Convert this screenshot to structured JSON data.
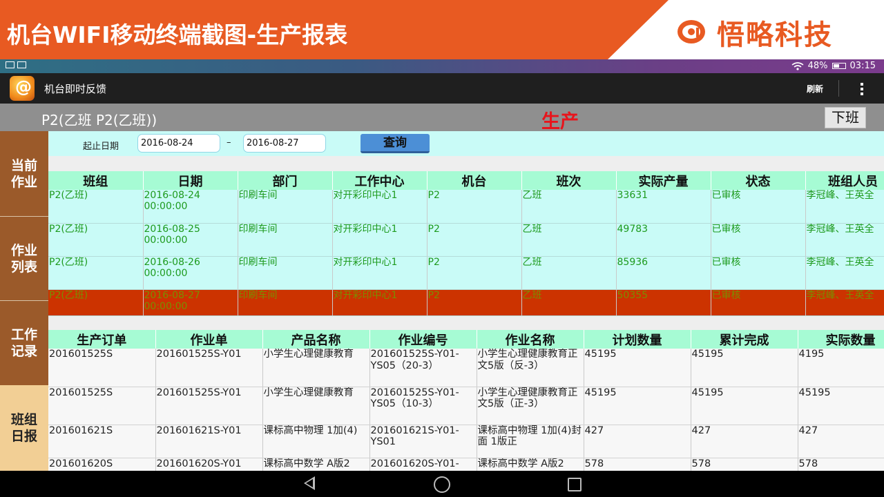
{
  "banner": {
    "title": "机台WIFI移动终端截图-生产报表",
    "brand": "悟略科技",
    "brand_color": "#e85a22"
  },
  "status_bar": {
    "battery": "48%",
    "time": "03:15",
    "icons": [
      "image-icon",
      "keyboard-icon",
      "wifi-icon",
      "battery-icon"
    ]
  },
  "app": {
    "title": "机台即时反馈",
    "refresh_label": "刷新",
    "overflow_icon": "more-vertical-icon"
  },
  "header": {
    "machine": "P2(乙班 P2(乙班))",
    "mode": "生产",
    "off_duty_label": "下班",
    "mode_color": "#e8141c"
  },
  "nav": {
    "items": [
      {
        "label": "当前作业"
      },
      {
        "label": "作业列表"
      },
      {
        "label": "工作记录"
      },
      {
        "label": "班组日报"
      }
    ]
  },
  "filter": {
    "label": "起止日期",
    "start_date": "2016-08-24",
    "separator": "–",
    "end_date": "2016-08-27",
    "query_label": "查询"
  },
  "report_table": {
    "headers": [
      "班组",
      "日期",
      "部门",
      "工作中心",
      "机台",
      "班次",
      "实际产量",
      "状态",
      "班组人员"
    ],
    "rows": [
      {
        "team": "P2(乙班)",
        "date": "2016-08-24",
        "time": "00:00:00",
        "dept": "印刷车间",
        "center": "对开彩印中心1",
        "machine": "P2",
        "shift": "乙班",
        "output": "33631",
        "status": "已审核",
        "members": "李冠峰、王英全"
      },
      {
        "team": "P2(乙班)",
        "date": "2016-08-25",
        "time": "00:00:00",
        "dept": "印刷车间",
        "center": "对开彩印中心1",
        "machine": "P2",
        "shift": "乙班",
        "output": "49783",
        "status": "已审核",
        "members": "李冠峰、王英全"
      },
      {
        "team": "P2(乙班)",
        "date": "2016-08-26",
        "time": "00:00:00",
        "dept": "印刷车间",
        "center": "对开彩印中心1",
        "machine": "P2",
        "shift": "乙班",
        "output": "85936",
        "status": "已审核",
        "members": "李冠峰、王英全"
      },
      {
        "team": "P2(乙班)",
        "date": "2016-08-27",
        "time": "00:00:00",
        "dept": "印刷车间",
        "center": "对开彩印中心1",
        "machine": "P2",
        "shift": "乙班",
        "output": "50355",
        "status": "已审核",
        "members": "李冠峰、王英全"
      }
    ]
  },
  "detail_table": {
    "headers": [
      "生产订单",
      "作业单",
      "产品名称",
      "作业编号",
      "作业名称",
      "计划数量",
      "累计完成",
      "实际数量"
    ],
    "rows": [
      {
        "order": "201601525S",
        "job": "201601525S-Y01",
        "product": "小学生心理健康教育",
        "job_no": "201601525S-Y01-YS05（20-3）",
        "job_name": "小学生心理健康教育正文5版（反-3）",
        "planned": "45195",
        "cumulative": "45195",
        "actual": "4195"
      },
      {
        "order": "201601525S",
        "job": "201601525S-Y01",
        "product": "小学生心理健康教育",
        "job_no": "201601525S-Y01-YS05（10-3）",
        "job_name": "小学生心理健康教育正文5版（正-3）",
        "planned": "45195",
        "cumulative": "45195",
        "actual": "45195"
      },
      {
        "order": "201601621S",
        "job": "201601621S-Y01",
        "product": "课标高中物理 1加(4)",
        "job_no": "201601621S-Y01-YS01",
        "job_name": "课标高中物理 1加(4)封面 1版正",
        "planned": "427",
        "cumulative": "427",
        "actual": "427"
      },
      {
        "order": "201601620S",
        "job": "201601620S-Y01",
        "product": "课标高中数学 A版2",
        "job_no": "201601620S-Y01-",
        "job_name": "课标高中数学 A版2",
        "planned": "578",
        "cumulative": "578",
        "actual": "578"
      }
    ]
  },
  "system_nav": {
    "icons": [
      "back-icon",
      "home-icon",
      "recent-apps-icon"
    ]
  }
}
